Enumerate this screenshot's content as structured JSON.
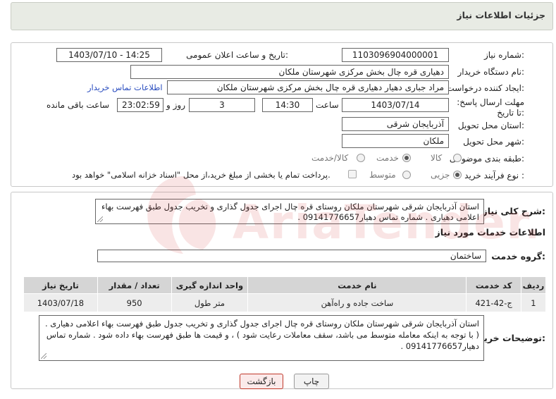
{
  "title": "جزئیات اطلاعات نیاز",
  "fields": {
    "need_number_label": "شماره نیاز:",
    "need_number": "1103096904000001",
    "announce_label": "تاریخ و ساعت اعلان عمومی:",
    "announce_value": "1403/07/10 - 14:25",
    "buyer_org_label": "نام دستگاه خریدار:",
    "buyer_org": "دهیاری قره چال بخش مرکزی شهرستان ملکان",
    "creator_label": "ایجاد کننده درخواست:",
    "creator": "مراد جباری دهیار دهیاری قره چال بخش مرکزی شهرستان ملکان",
    "contact_link": "اطلاعات تماس خریدار",
    "deadline_label": "مهلت ارسال پاسخ: تا تاریخ:",
    "deadline_date": "1403/07/14",
    "time_label": "ساعت",
    "deadline_time": "14:30",
    "day_label": "روز و",
    "days": "3",
    "remaining_time": "23:02:59",
    "remaining_label": "ساعت باقی مانده",
    "province_label": "استان محل تحویل:",
    "province": "آذربایجان شرقی",
    "city_label": "شهر محل تحویل:",
    "city": "ملکان",
    "category_label": "طبقه بندی موضوعی:",
    "category_options": [
      "کالا",
      "خدمت",
      "کالا/خدمت"
    ],
    "category_selected": "خدمت",
    "process_label": "نوع فرآیند خرید :",
    "process_options": [
      "جزیی",
      "متوسط"
    ],
    "process_selected": "جزیی",
    "payment_note": "پرداخت تمام یا بخشی از مبلغ خرید،از محل \"اسناد خزانه اسلامی\" خواهد بود."
  },
  "summary": {
    "label": "شرح کلی نیاز:",
    "text": "استان آذربایجان شرقی شهرستان ملکان روستای قره چال اجرای جدول گذاری و تخریب جدول طبق فهرست بهاء اعلامی دهیاری . شماره تماس دهیار09141776657 ."
  },
  "services": {
    "section_title": "اطلاعات خدمات مورد نیاز",
    "group_label": "گروه خدمت:",
    "group_value": "ساختمان",
    "columns": [
      "ردیف",
      "کد خدمت",
      "نام خدمت",
      "واحد اندازه گیری",
      "تعداد / مقدار",
      "تاریخ نیاز"
    ],
    "rows": [
      {
        "index": "1",
        "code": "ج-42-421",
        "name": "ساخت جاده و راه‌آهن",
        "unit": "متر طول",
        "qty": "950",
        "date": "1403/07/18"
      }
    ]
  },
  "buyer_notes": {
    "label": "توضیحات خریدار:",
    "text": "استان آذربایجان شرقی شهرستان ملکان روستای قره چال اجرای جدول گذاری و تخریب جدول طبق فهرست بهاء اعلامی دهیاری . ( با توجه به اینکه معامله متوسط می باشد، سقف معاملات رعایت شود ) ، و قیمت ها طبق فهرست بهاء داده شود . شماره تماس دهیار09141776657 ."
  },
  "buttons": {
    "print": "چاپ",
    "back": "بازگشت"
  },
  "watermark": {
    "text": "AriaTender.net"
  },
  "colors": {
    "link": "#2a4dbf",
    "title_bg": "#e8ebe4",
    "back_border": "#c0392b"
  }
}
